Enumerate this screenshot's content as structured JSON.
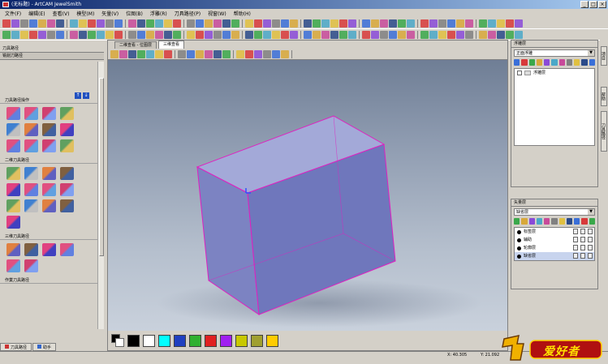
{
  "window": {
    "title": "(无标题) - ArtCAM JewelSmith"
  },
  "menu": [
    "文件(F)",
    "编辑(E)",
    "查看(V)",
    "模型(M)",
    "矢量(V)",
    "位图(B)",
    "浮雕(R)",
    "刀具路径(P)",
    "视窗(W)",
    "帮助(H)"
  ],
  "left_panel": {
    "title": "刀具路径",
    "subtitle": "铣削刀路径",
    "sections": [
      "刀具路径操作",
      "二维刀具路径",
      "三维刀具路径",
      "作業刀具路径"
    ]
  },
  "tabs": [
    "二维查看 - 位图层",
    "三维查看"
  ],
  "right_panel": {
    "relief_title": "浮雕层",
    "relief_dropdown": "正面浮雕",
    "relief_items": [
      "浮雕层"
    ],
    "vector_title": "矢量层",
    "vector_dropdown": "缺省层",
    "vector_items": [
      "标签层",
      "辅助",
      "轮廓层",
      "缺省层"
    ]
  },
  "side_tabs": [
    "项目",
    "帮助",
    "刀具路径"
  ],
  "bottom_tabs": [
    "刀具路径",
    "助手"
  ],
  "status": {
    "x": "X: 40.305",
    "y": "Y: 21.092"
  },
  "logo_text": "爱好者",
  "colors": {
    "palette": [
      "#000000",
      "#ffffff",
      "#00ffff",
      "#2040c0",
      "#30b030",
      "#e02020",
      "#a020f0",
      "#c8c800",
      "#a0a030",
      "#ffcc00"
    ],
    "accent": "#0a246a",
    "box_edge": "#e020c0"
  }
}
